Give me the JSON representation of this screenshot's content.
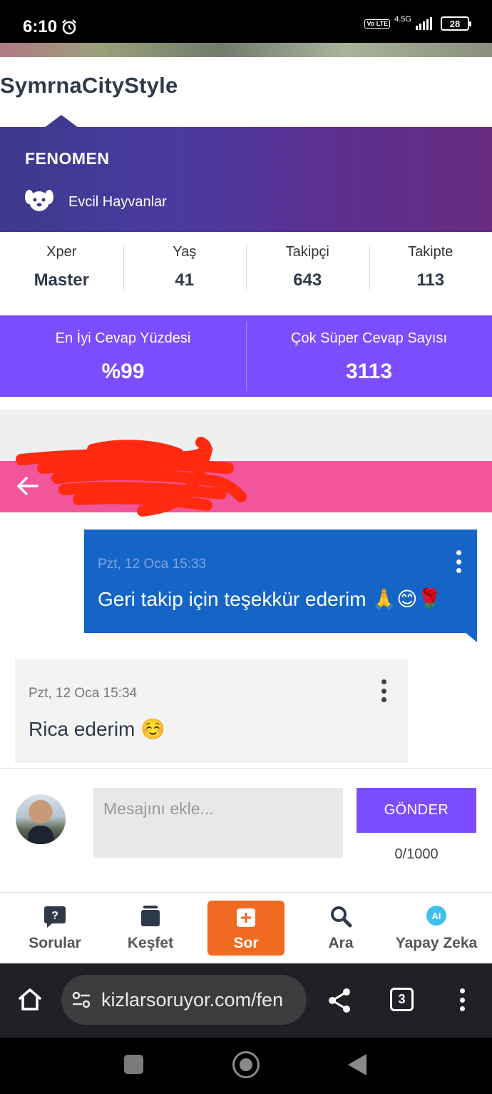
{
  "status_bar": {
    "time": "6:10",
    "volte": "Vo LTE",
    "network": "4.5G",
    "battery": "28"
  },
  "profile": {
    "username": "SymrnaCityStyle",
    "badge": "FENOMEN",
    "category": "Evcil Hayvanlar"
  },
  "stats": [
    {
      "label": "Xper",
      "value": "Master"
    },
    {
      "label": "Yaş",
      "value": "41"
    },
    {
      "label": "Takipçi",
      "value": "643"
    },
    {
      "label": "Takipte",
      "value": "113"
    }
  ],
  "scores": [
    {
      "label": "En İyi Cevap Yüzdesi",
      "value": "%99"
    },
    {
      "label": "Çok Süper Cevap Sayısı",
      "value": "3113"
    }
  ],
  "messages": [
    {
      "direction": "outgoing",
      "time": "Pzt, 12 Oca 15:33",
      "text": "Geri takip için teşekkür ederim 🙏😊🌹"
    },
    {
      "direction": "incoming",
      "time": "Pzt, 12 Oca 15:34",
      "text": "Rica ederim ☺️"
    }
  ],
  "composer": {
    "placeholder": "Mesajını ekle...",
    "send_label": "GÖNDER",
    "char_count": "0/1000"
  },
  "bottom_nav": [
    {
      "label": "Sorular",
      "icon": "question-bubble-icon"
    },
    {
      "label": "Keşfet",
      "icon": "cards-stack-icon"
    },
    {
      "label": "Sor",
      "icon": "plus-icon"
    },
    {
      "label": "Ara",
      "icon": "search-icon"
    },
    {
      "label": "Yapay Zeka",
      "icon": "ai-icon"
    }
  ],
  "browser": {
    "url": "kizlarsoruyor.com/fen",
    "tab_count": "3"
  },
  "colors": {
    "banner_gradient_start": "#3c3a8c",
    "banner_gradient_end": "#672c80",
    "accent_purple": "#7b4dff",
    "pink_bar": "#f3559a",
    "outgoing_bubble": "#1565c8",
    "ask_button": "#f06a21"
  }
}
